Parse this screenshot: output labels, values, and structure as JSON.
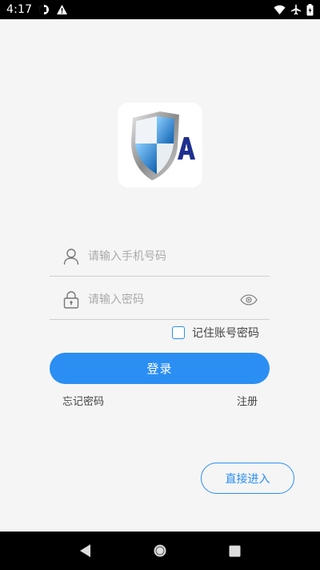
{
  "status_bar": {
    "time": "4:17",
    "icons": [
      "notification-icon",
      "alert-icon",
      "wifi-icon",
      "airplane-icon",
      "battery-icon"
    ]
  },
  "logo": {
    "letter": "A",
    "icon": "shield-logo-icon"
  },
  "form": {
    "phone_placeholder": "请输入手机号码",
    "password_placeholder": "请输入密码",
    "phone_value": "",
    "password_value": "",
    "remember_label": "记住账号密码",
    "remember_checked": false
  },
  "actions": {
    "login_label": "登录",
    "forgot_label": "忘记密码",
    "register_label": "注册",
    "direct_enter_label": "直接进入"
  },
  "colors": {
    "accent": "#2b8ef3",
    "background": "#f5f5f5"
  },
  "nav_bar": {
    "icons": [
      "back-icon",
      "home-icon",
      "recents-icon"
    ]
  }
}
